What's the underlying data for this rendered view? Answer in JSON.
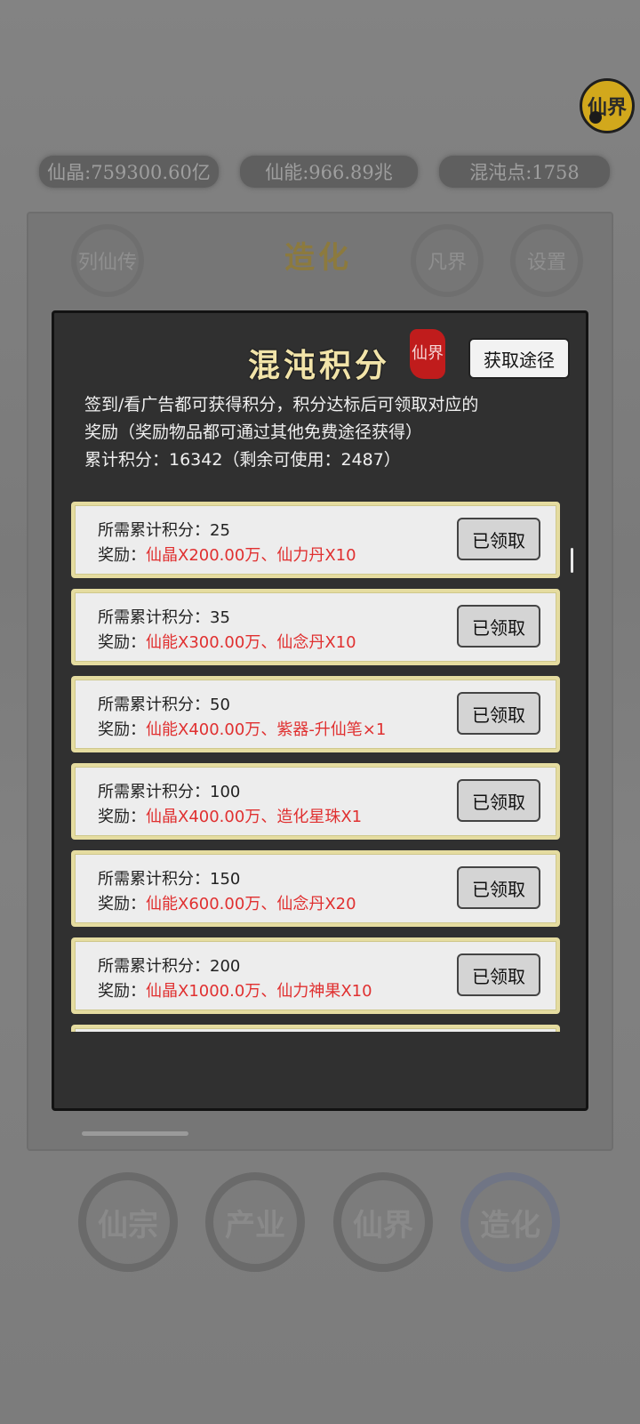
{
  "currency": {
    "crystal": "仙晶:759300.60亿",
    "energy": "仙能:966.89兆",
    "chaos": "混沌点:1758"
  },
  "badge_text": "仙界",
  "background_panel": {
    "title": "造化",
    "tabs": [
      "列仙传",
      "凡界",
      "设置"
    ]
  },
  "bottom_nav": [
    "仙宗",
    "产业",
    "仙界",
    "造化"
  ],
  "modal": {
    "title": "混沌积分",
    "seal_text": "仙界",
    "get_button": "获取途径",
    "description_line1": "签到/看广告都可获得积分，积分达标后可领取对应的",
    "description_line2": "奖励（奖励物品都可通过其他免费途径获得）",
    "total_points": "累计积分：16342（剩余可使用：2487）",
    "rewards": [
      {
        "required_label": "所需累计积分：",
        "required": "25",
        "reward_label": "奖励：",
        "reward": "仙晶X200.00万、仙力丹X10",
        "button": "已领取"
      },
      {
        "required_label": "所需累计积分：",
        "required": "35",
        "reward_label": "奖励：",
        "reward": "仙能X300.00万、仙念丹X10",
        "button": "已领取"
      },
      {
        "required_label": "所需累计积分：",
        "required": "50",
        "reward_label": "奖励：",
        "reward": "仙能X400.00万、紫器-升仙笔×1",
        "button": "已领取"
      },
      {
        "required_label": "所需累计积分：",
        "required": "100",
        "reward_label": "奖励：",
        "reward": "仙晶X400.00万、造化星珠X1",
        "button": "已领取"
      },
      {
        "required_label": "所需累计积分：",
        "required": "150",
        "reward_label": "奖励：",
        "reward": "仙能X600.00万、仙念丹X20",
        "button": "已领取"
      },
      {
        "required_label": "所需累计积分：",
        "required": "200",
        "reward_label": "奖励：",
        "reward": "仙晶X1000.0万、仙力神果X10",
        "button": "已领取"
      }
    ]
  },
  "colors": {
    "reward_text": "#e03030",
    "card_border": "#e5dca0",
    "modal_bg": "#303030",
    "title_gold": "#f2e4a9"
  }
}
